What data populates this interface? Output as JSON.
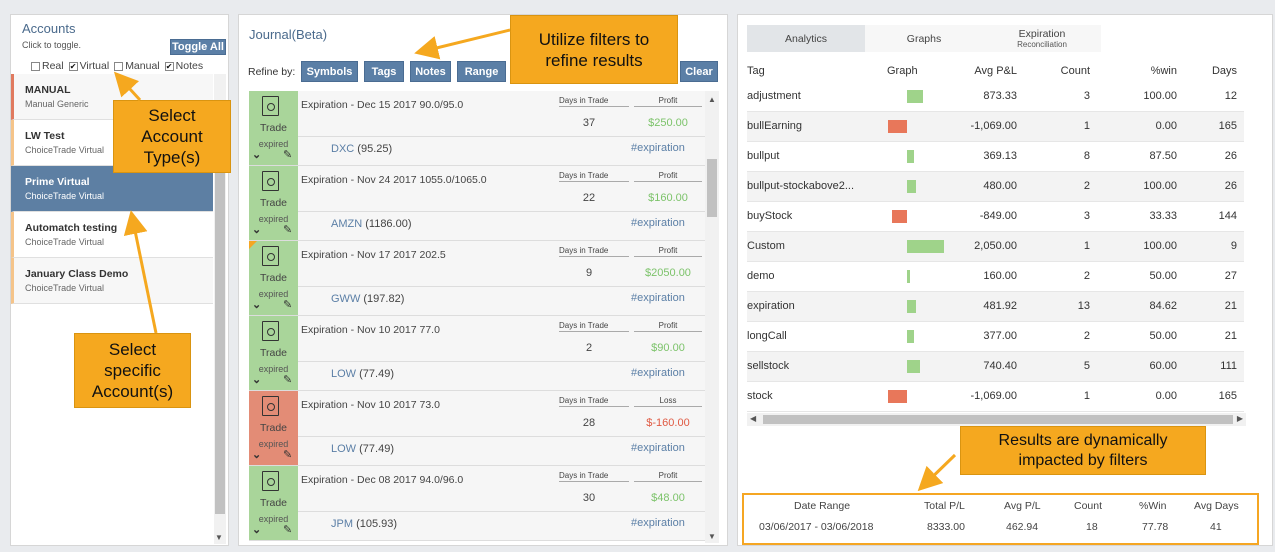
{
  "accounts": {
    "title": "Accounts",
    "subtitle": "Click to toggle.",
    "toggle_all": "Toggle All",
    "types": [
      {
        "label": "Real",
        "checked": false
      },
      {
        "label": "Virtual",
        "checked": true
      },
      {
        "label": "Manual",
        "checked": false
      },
      {
        "label": "Notes",
        "checked": true
      }
    ],
    "items": [
      {
        "name": "MANUAL",
        "type": "Manual Generic"
      },
      {
        "name": "LW Test",
        "type": "ChoiceTrade Virtual"
      },
      {
        "name": "Prime Virtual",
        "type": "ChoiceTrade Virtual"
      },
      {
        "name": "Automatch testing",
        "type": "ChoiceTrade Virtual"
      },
      {
        "name": "January Class Demo",
        "type": "ChoiceTrade Virtual"
      }
    ]
  },
  "journal": {
    "title": "Journal(Beta)",
    "refine_label": "Refine by:",
    "filters": [
      "Symbols",
      "Tags",
      "Notes",
      "Range"
    ],
    "clear": "Clear",
    "days_header": "Days in Trade",
    "trades": [
      {
        "title": "Expiration - Dec 15 2017 90.0/95.0",
        "days": "37",
        "pl_label": "Profit",
        "pl": "$250.00",
        "ticker": "DXC",
        "price": "(95.25)",
        "tag": "#expiration",
        "status1": "Trade",
        "status2": "expired"
      },
      {
        "title": "Expiration - Nov 24 2017 1055.0/1065.0",
        "days": "22",
        "pl_label": "Profit",
        "pl": "$160.00",
        "ticker": "AMZN",
        "price": "(1186.00)",
        "tag": "#expiration",
        "status1": "Trade",
        "status2": "expired"
      },
      {
        "title": "Expiration - Nov 17 2017 202.5",
        "days": "9",
        "pl_label": "Profit",
        "pl": "$2050.00",
        "ticker": "GWW",
        "price": "(197.82)",
        "tag": "#expiration",
        "status1": "Trade",
        "status2": "expired"
      },
      {
        "title": "Expiration - Nov 10 2017 77.0",
        "days": "2",
        "pl_label": "Profit",
        "pl": "$90.00",
        "ticker": "LOW",
        "price": "(77.49)",
        "tag": "#expiration",
        "status1": "Trade",
        "status2": "expired"
      },
      {
        "title": "Expiration - Nov 10 2017 73.0",
        "days": "28",
        "pl_label": "Loss",
        "pl": "$-160.00",
        "ticker": "LOW",
        "price": "(77.49)",
        "tag": "#expiration",
        "status1": "Trade",
        "status2": "expired"
      },
      {
        "title": "Expiration - Dec 08 2017 94.0/96.0",
        "days": "30",
        "pl_label": "Profit",
        "pl": "$48.00",
        "ticker": "JPM",
        "price": "(105.93)",
        "tag": "#expiration",
        "status1": "Trade",
        "status2": "expired"
      }
    ]
  },
  "analytics": {
    "tabs": [
      {
        "label": "Analytics",
        "sub": ""
      },
      {
        "label": "Graphs",
        "sub": ""
      },
      {
        "label": "Expiration",
        "sub": "Reconciliation"
      }
    ],
    "columns": [
      "Tag",
      "Graph",
      "Avg P&L",
      "Count",
      "%win",
      "Days"
    ],
    "rows": [
      {
        "tag": "adjustment",
        "avg": "873.33",
        "count": "3",
        "win": "100.00",
        "days": "12",
        "value": 873.33
      },
      {
        "tag": "bullEarning",
        "avg": "-1,069.00",
        "count": "1",
        "win": "0.00",
        "days": "165",
        "value": -1069.0
      },
      {
        "tag": "bullput",
        "avg": "369.13",
        "count": "8",
        "win": "87.50",
        "days": "26",
        "value": 369.13
      },
      {
        "tag": "bullput-stockabove2...",
        "avg": "480.00",
        "count": "2",
        "win": "100.00",
        "days": "26",
        "value": 480.0
      },
      {
        "tag": "buyStock",
        "avg": "-849.00",
        "count": "3",
        "win": "33.33",
        "days": "144",
        "value": -849.0
      },
      {
        "tag": "Custom",
        "avg": "2,050.00",
        "count": "1",
        "win": "100.00",
        "days": "9",
        "value": 2050.0
      },
      {
        "tag": "demo",
        "avg": "160.00",
        "count": "2",
        "win": "50.00",
        "days": "27",
        "value": 160.0
      },
      {
        "tag": "expiration",
        "avg": "481.92",
        "count": "13",
        "win": "84.62",
        "days": "21",
        "value": 481.92
      },
      {
        "tag": "longCall",
        "avg": "377.00",
        "count": "2",
        "win": "50.00",
        "days": "21",
        "value": 377.0
      },
      {
        "tag": "sellstock",
        "avg": "740.40",
        "count": "5",
        "win": "60.00",
        "days": "111",
        "value": 740.4
      },
      {
        "tag": "stock",
        "avg": "-1,069.00",
        "count": "1",
        "win": "0.00",
        "days": "165",
        "value": -1069.0
      }
    ],
    "summary": {
      "headers": [
        "Date Range",
        "Total P/L",
        "Avg P/L",
        "Count",
        "%Win",
        "Avg Days"
      ],
      "values": [
        "03/06/2017 - 03/06/2018",
        "8333.00",
        "462.94",
        "18",
        "77.78",
        "41"
      ]
    }
  },
  "callouts": {
    "filters": [
      "Utilize  filters to",
      "refine results"
    ],
    "acctype": [
      "Select",
      "Account",
      "Type(s)"
    ],
    "specific": [
      "Select",
      "specific",
      "Account(s)"
    ],
    "results": [
      "Results are dynamically",
      "impacted by filters"
    ]
  },
  "colors": {
    "accent": "#5b7fa6",
    "profit": "#7cc36a",
    "loss": "#e05a43",
    "callout": "#f5a81f",
    "bar_pos": "#9fd38a",
    "bar_neg": "#e8775a"
  }
}
